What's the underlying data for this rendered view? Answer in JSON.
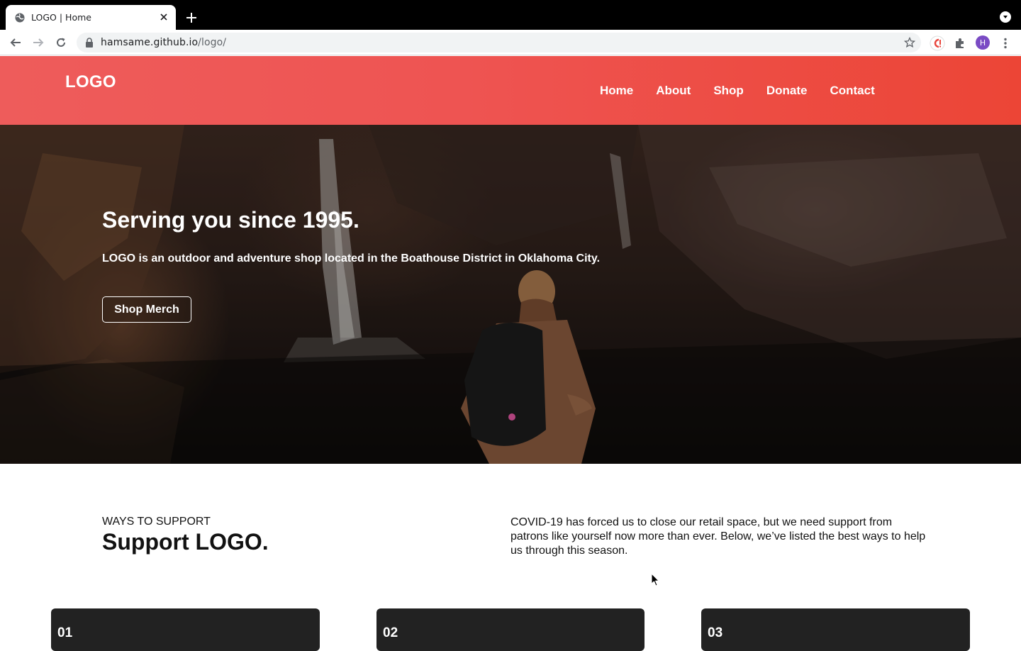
{
  "browser": {
    "tab_title": "LOGO | Home",
    "url_domain": "hamsame.github.io",
    "url_path": "/logo/",
    "profile_initial": "H"
  },
  "site": {
    "logo": "LOGO",
    "nav": [
      "Home",
      "About",
      "Shop",
      "Donate",
      "Contact"
    ],
    "header_color": "#ee5452"
  },
  "hero": {
    "title": "Serving you since 1995.",
    "subtitle": "LOGO is an outdoor and adventure shop located in the Boathouse District in Oklahoma City.",
    "button": "Shop Merch"
  },
  "support": {
    "eyebrow": "WAYS TO SUPPORT",
    "title": "Support LOGO.",
    "description": "COVID-19 has forced us to close our retail space, but we need support from patrons like yourself now more than ever. Below, we’ve listed the best ways to help us through this season.",
    "cards": [
      "01",
      "02",
      "03"
    ]
  }
}
